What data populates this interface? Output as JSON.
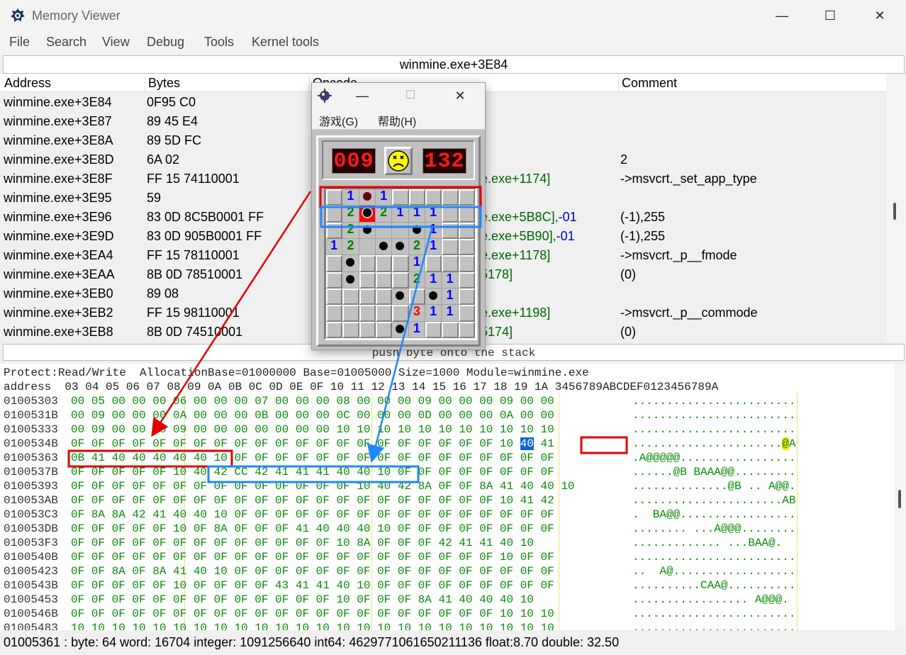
{
  "window": {
    "title": "Memory Viewer",
    "minimize": "—",
    "maximize": "☐",
    "close": "✕"
  },
  "menu": [
    "File",
    "Search",
    "View",
    "Debug",
    "Tools",
    "Kernel tools"
  ],
  "path": "winmine.exe+3E84",
  "disasm": {
    "headers": [
      "Address",
      "Bytes",
      "Opcode",
      "Comment"
    ],
    "rows": [
      {
        "addr": "winmine.exe+3E84",
        "bytes": "0F95 C0",
        "opcode": "",
        "opcode_tail": "",
        "comment": ""
      },
      {
        "addr": "winmine.exe+3E87",
        "bytes": "89 45 E4",
        "opcode": "",
        "opcode_tail": "",
        "comment": ""
      },
      {
        "addr": "winmine.exe+3E8A",
        "bytes": "89 5D FC",
        "opcode": "",
        "opcode_tail": "",
        "comment": ""
      },
      {
        "addr": "winmine.exe+3E8D",
        "bytes": "6A 02",
        "opcode": "",
        "opcode_tail": "",
        "comment": "2"
      },
      {
        "addr": "winmine.exe+3E8F",
        "bytes": "FF 15 74110001",
        "opcode": "e.exe+1174]",
        "opcode_tail": "",
        "comment": "->msvcrt._set_app_type"
      },
      {
        "addr": "winmine.exe+3E95",
        "bytes": "59",
        "opcode": "",
        "opcode_tail": "",
        "comment": ""
      },
      {
        "addr": "winmine.exe+3E96",
        "bytes": "83 0D 8C5B0001 FF",
        "opcode": "e.exe+5B8C],",
        "opcode_tail": "-01",
        "comment": "(-1),255"
      },
      {
        "addr": "winmine.exe+3E9D",
        "bytes": "83 0D 905B0001 FF",
        "opcode": "e.exe+5B90],",
        "opcode_tail": "-01",
        "comment": "(-1),255"
      },
      {
        "addr": "winmine.exe+3EA4",
        "bytes": "FF 15 78110001",
        "opcode": "e.exe+1178]",
        "opcode_tail": "",
        "comment": "->msvcrt._p__fmode"
      },
      {
        "addr": "winmine.exe+3EAA",
        "bytes": "8B 0D 78510001",
        "opcode": "5178]",
        "opcode_tail": "",
        "comment": "(0)"
      },
      {
        "addr": "winmine.exe+3EB0",
        "bytes": "89 08",
        "opcode": "",
        "opcode_tail": "",
        "comment": ""
      },
      {
        "addr": "winmine.exe+3EB2",
        "bytes": "FF 15 98110001",
        "opcode": "e.exe+1198]",
        "opcode_tail": "",
        "comment": "->msvcrt._p__commode"
      },
      {
        "addr": "winmine.exe+3EB8",
        "bytes": "8B 0D 74510001",
        "opcode": "5174]",
        "opcode_tail": "",
        "comment": "(0)"
      }
    ]
  },
  "hint": "push byte onto the stack",
  "hex": {
    "info": "Protect:Read/Write  AllocationBase=01000000 Base=01005000 Size=1000 Module=winmine.exe",
    "header": "address  03 04 05 06 07 08 09 0A 0B 0C 0D 0E 0F 10 11 12 13 14 15 16 17 18 19 1A 3456789ABCDEF0123456789A",
    "rows": [
      {
        "addr": "01005303",
        "bytes": "00 05 00 00 00 06 00 00 00 07 00 00 00 08 00 00 00 09 00 00 00 09 00 00",
        "ascii": "........................"
      },
      {
        "addr": "0100531B",
        "bytes": "00 09 00 00 00 0A 00 00 00 0B 00 00 00 0C 00 00 00 0D 00 00 00 0A 00 00",
        "ascii": "........................"
      },
      {
        "addr": "01005333",
        "bytes": "00 09 00 00 00 09 00 00 00 00 00 00 00 10 10 10 10 10 10 10 10 10 10 10",
        "ascii": "........................"
      },
      {
        "addr": "0100534B",
        "bytes_a": "0F 0F 0F 0F 0F 0F 0F 0F 0F 0F 0F 0F 0F 0F 0F 0F 0F 0F 0F 0F 0F 10 ",
        "bytes_sel": "40",
        "bytes_b": " 41",
        "ascii_a": "......................",
        "ascii_y": "@",
        "ascii_b": "A"
      },
      {
        "addr": "01005363",
        "bytes": "0B 41 40 40 40 40 40 10 0F 0F 0F 0F 0F 0F 0F 0F 0F 0F 0F 0F 0F 0F 0F 0F",
        "ascii": ".A@@@@@................."
      },
      {
        "addr": "0100537B",
        "bytes": "0F 0F 0F 0F 0F 10 40 42 CC 42 41 41 41 40 40 10 0F 0F 0F 0F 0F 0F 0F 0F",
        "ascii": "......@B BAAA@@........."
      },
      {
        "addr": "01005393",
        "bytes": "0F 0F 0F 0F 0F 0F 0F 0F 0F 0F 0F 0F 0F 0F 10 40 42 8A 0F 0F 8A 41 40 40 10",
        "ascii": "..............@B .. A@@."
      },
      {
        "addr": "010053AB",
        "bytes": "0F 0F 0F 0F 0F 0F 0F 0F 0F 0F 0F 0F 0F 0F 0F 0F 0F 0F 0F 0F 0F 10 41 42",
        "ascii": "......................AB"
      },
      {
        "addr": "010053C3",
        "bytes": "0F 8A 8A 42 41 40 40 10 0F 0F 0F 0F 0F 0F 0F 0F 0F 0F 0F 0F 0F 0F 0F 0F",
        "ascii": ".  BA@@................."
      },
      {
        "addr": "010053DB",
        "bytes": "0F 0F 0F 0F 0F 10 0F 8A 0F 0F 0F 41 40 40 40 10 0F 0F 0F 0F 0F 0F 0F 0F",
        "ascii": "........ ...A@@@........"
      },
      {
        "addr": "010053F3",
        "bytes": "0F 0F 0F 0F 0F 0F 0F 0F 0F 0F 0F 0F 0F 10 8A 0F 0F 0F 42 41 41 40 10",
        "ascii": "............. ...BAA@."
      },
      {
        "addr": "0100540B",
        "bytes": "0F 0F 0F 0F 0F 0F 0F 0F 0F 0F 0F 0F 0F 0F 0F 0F 0F 0F 0F 0F 0F 10 0F 0F",
        "ascii": "........................"
      },
      {
        "addr": "01005423",
        "bytes": "0F 0F 8A 0F 8A 41 40 10 0F 0F 0F 0F 0F 0F 0F 0F 0F 0F 0F 0F 0F 0F 0F 0F",
        "ascii": "..  A@.................."
      },
      {
        "addr": "0100543B",
        "bytes": "0F 0F 0F 0F 0F 10 0F 0F 0F 0F 43 41 41 40 10 0F 0F 0F 0F 0F 0F 0F 0F 0F",
        "ascii": "..........CAA@.........."
      },
      {
        "addr": "01005453",
        "bytes": "0F 0F 0F 0F 0F 0F 0F 0F 0F 0F 0F 0F 0F 10 0F 0F 0F 8A 41 40 40 40 10",
        "ascii": "................. A@@@."
      },
      {
        "addr": "0100546B",
        "bytes": "0F 0F 0F 0F 0F 0F 0F 0F 0F 0F 0F 0F 0F 0F 0F 0F 0F 0F 0F 0F 0F 10 10 10",
        "ascii": "........................"
      },
      {
        "addr": "01005483",
        "bytes": "10 10 10 10 10 10 10 10 10 10 10 10 10 10 10 10 10 10 10 10 10 10 10 10",
        "ascii": "........................"
      }
    ]
  },
  "status": "01005361 : byte: 64 word: 16704 integer: 1091256640 int64: 4629771061650211136 float:8.70 double: 32.50",
  "minesweeper": {
    "title": "",
    "menu": [
      "游戏(G)",
      "帮助(H)"
    ],
    "mines_left": "009",
    "timer": "132",
    "board": [
      [
        "u",
        "1",
        "mx",
        "1",
        "u",
        "u",
        "u",
        "u",
        "u"
      ],
      [
        "u",
        "2",
        "mr",
        "2",
        "1",
        "1",
        "1",
        "u",
        "u"
      ],
      [
        "u",
        "2",
        "m",
        "o",
        "o",
        "m",
        "1",
        "u",
        "u"
      ],
      [
        "1",
        "2",
        "o",
        "m",
        "m",
        "2",
        "1",
        "u",
        "u"
      ],
      [
        "u",
        "m",
        "u",
        "u",
        "u",
        "1",
        "u",
        "u",
        "u"
      ],
      [
        "u",
        "m",
        "u",
        "u",
        "u",
        "2",
        "1",
        "1",
        "u"
      ],
      [
        "u",
        "u",
        "u",
        "u",
        "m",
        "u",
        "m",
        "1",
        "u"
      ],
      [
        "u",
        "u",
        "u",
        "u",
        "u",
        "3",
        "1",
        "1",
        "u"
      ],
      [
        "u",
        "u",
        "u",
        "u",
        "m",
        "1",
        "u",
        "u",
        "u"
      ]
    ]
  },
  "colors": {
    "highlight_red": "#e00000",
    "highlight_blue": "#1e88ff",
    "hex_green": "#0a8a0a",
    "selected": "#0a64d6"
  }
}
